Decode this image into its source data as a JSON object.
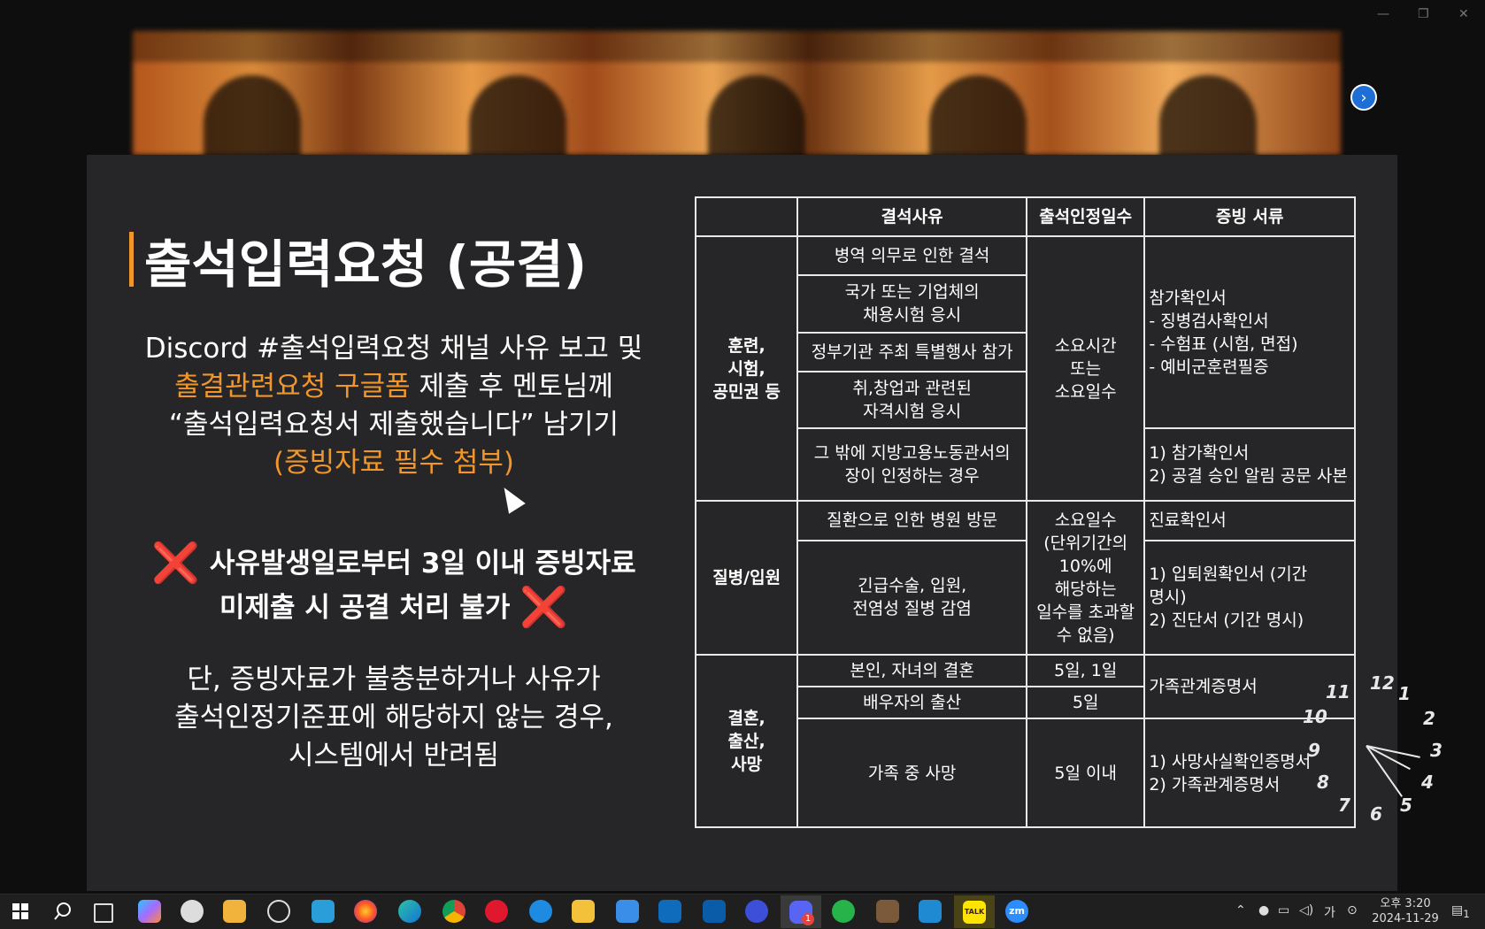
{
  "slide": {
    "title": "출석입력요청 (공결)",
    "para1_line1": "Discord #출석입력요청 채널 사유 보고 및",
    "para1_link": "출결관련요청 구글폼",
    "para1_line2_rest": " 제출 후 멘토님께",
    "para1_line3": "“출석입력요청서 제출했습니다” 남기기",
    "para1_note": "(증빙자료 필수 첨부)",
    "warning_mark": "❌",
    "warning_line1": "사유발생일로부터 3일 이내 증빙자료",
    "warning_line2": "미제출 시 공결 처리 불가",
    "para2_line1": "단, 증빙자료가 불충분하거나 사유가",
    "para2_line2": "출석인정기준표에 해당하지 않는 경우,",
    "para2_line3": "시스템에서 반려됨"
  },
  "table": {
    "headers": [
      "",
      "결석사유",
      "출석인정일수",
      "증빙 서류"
    ],
    "g1_category": [
      "훈련,",
      "시험,",
      "공민권 등"
    ],
    "g1_reasons": [
      "병역 의무로 인한 결석",
      "국가 또는 기업체의",
      "채용시험 응시",
      "정부기관 주최 특별행사 참가",
      "취,창업과 관련된",
      "자격시험 응시",
      "그 밖에 지방고용노동관서의",
      "장이 인정하는 경우"
    ],
    "g1_days": [
      "소요시간",
      "또는",
      "소요일수"
    ],
    "g1_docs_a": [
      "참가확인서",
      "- 징병검사확인서",
      "- 수험표 (시험, 면접)",
      "- 예비군훈련필증"
    ],
    "g1_docs_b": [
      "1) 참가확인서",
      "2) 공결 승인 알림 공문 사본"
    ],
    "g2_category": "질병/입원",
    "g2_reasons": [
      "질환으로 인한 병원 방문",
      "긴급수술, 입원,",
      "전염성 질병 감염"
    ],
    "g2_days": [
      "소요일수",
      "(단위기간의",
      "10%에",
      "해당하는",
      "일수를 초과할",
      "수 없음)"
    ],
    "g2_docs_a": "진료확인서",
    "g2_docs_b": [
      "1) 입퇴원확인서 (기간",
      "명시)",
      "2) 진단서 (기간 명시)"
    ],
    "g3_category": [
      "결혼,",
      "출산,",
      "사망"
    ],
    "g3_reasons": [
      "본인, 자녀의 결혼",
      "배우자의 출산",
      "가족 중 사망"
    ],
    "g3_days": [
      "5일, 1일",
      "5일",
      "5일 이내"
    ],
    "g3_docs_a": "가족관계증명서",
    "g3_docs_b": [
      "1) 사망사실확인증명서",
      "2) 가족관계증명서"
    ]
  },
  "clock_numbers": [
    "12",
    "1",
    "2",
    "3",
    "4",
    "5",
    "6",
    "7",
    "8",
    "9",
    "10",
    "11"
  ],
  "taskbar": {
    "icons": [
      "windows-start-icon",
      "search-icon",
      "task-view-icon",
      "copilot-icon",
      "clock-app-icon",
      "notes-icon",
      "chatgpt-icon",
      "app-icon",
      "firefox-icon",
      "edge-icon",
      "chrome-icon",
      "opera-icon",
      "ie-icon",
      "file-explorer-icon",
      "store-icon",
      "outlook-icon",
      "outlook-classic-icon",
      "app2-icon",
      "discord-icon",
      "sync-icon",
      "game-icon",
      "vscode-icon",
      "kakaotalk-icon",
      "zoom-icon"
    ],
    "discord_badge": "1",
    "kakao_label": "TALK",
    "zoom_label": "zm",
    "ime": "가",
    "time": "오후 3:20",
    "date": "2024-11-29",
    "notif_count": "1"
  },
  "colors": {
    "accent": "#f0962a",
    "warning": "#ff3f5c",
    "slide_bg": "#262527",
    "taskbar_bg": "#1f1f1f"
  }
}
